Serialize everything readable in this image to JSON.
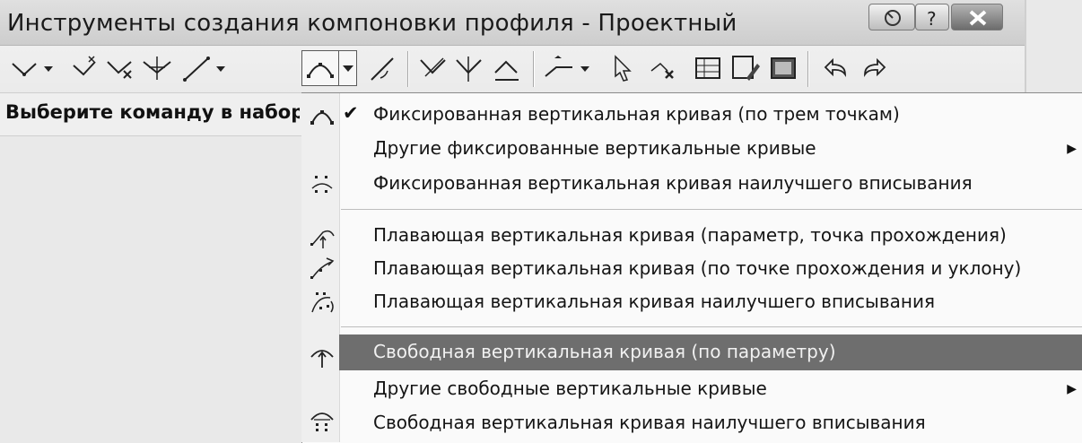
{
  "window": {
    "title": "Инструменты создания компоновки профиля - Проектный",
    "caption_buttons": [
      "help-icon",
      "question-icon",
      "close-icon"
    ]
  },
  "toolbar": {
    "buttons": [
      "pvi-insert-icon",
      "pvi-delete-icon",
      "pvi-move-icon",
      "pvi-edit-icon",
      "line-tangent-icon",
      "vertical-curve-icon",
      "curve-settings-icon",
      "pvi-based-icon",
      "insert-pvi-icon",
      "delete-pvi-icon",
      "grade-icon",
      "select-entity-icon",
      "delete-entity-icon",
      "grid-view-icon",
      "edit-view-icon",
      "panorama-icon",
      "undo-icon",
      "redo-icon"
    ]
  },
  "status": {
    "prompt": "Выберите команду в наборе и"
  },
  "menu": {
    "items": [
      {
        "label": "Фиксированная вертикальная кривая (по трем точкам)",
        "checked": true
      },
      {
        "label": "Другие фиксированные вертикальные кривые",
        "submenu": true
      },
      {
        "label": "Фиксированная вертикальная кривая наилучшего вписывания"
      },
      {
        "label": "Плавающая вертикальная кривая (параметр, точка прохождения)"
      },
      {
        "label": "Плавающая вертикальная кривая (по точке прохождения и уклону)"
      },
      {
        "label": "Плавающая вертикальная кривая наилучшего вписывания"
      },
      {
        "label": "Свободная вертикальная кривая (по параметру)",
        "highlighted": true
      },
      {
        "label": "Другие свободные вертикальные кривые",
        "submenu": true
      },
      {
        "label": "Свободная вертикальная кривая наилучшего вписывания"
      }
    ],
    "check_glyph": "✔",
    "submenu_glyph": "▶",
    "highlight_color": "#6e6e6e"
  }
}
